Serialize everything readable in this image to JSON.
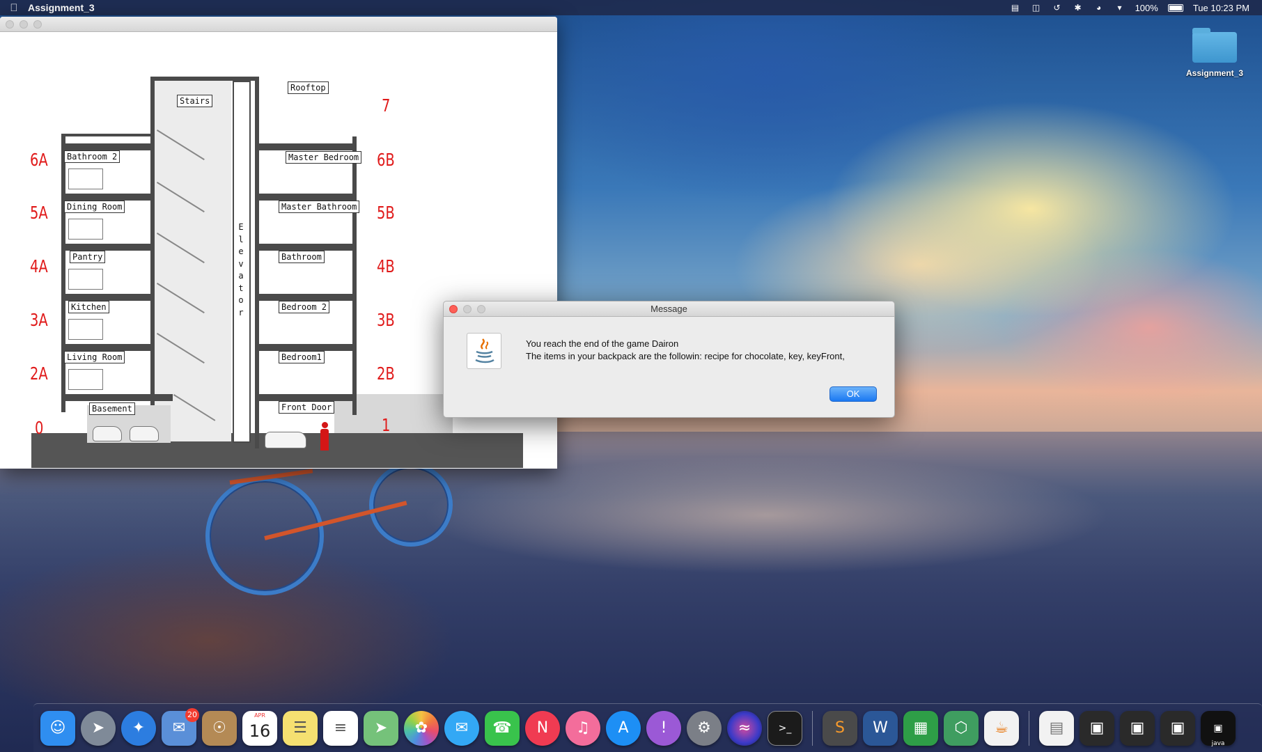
{
  "menubar": {
    "app_name": "Assignment_3",
    "battery": "100%",
    "clock": "Tue 10:23 PM",
    "icons": [
      "apple-icon",
      "notification-icon",
      "mission-control-icon",
      "time-machine-icon",
      "bluetooth-icon",
      "wifi-icon",
      "volume-icon",
      "battery-icon"
    ]
  },
  "desktop": {
    "icons": [
      {
        "label": "Assignment_3",
        "icon": "folder-icon"
      }
    ]
  },
  "game": {
    "rooms": {
      "rooftop": "Rooftop",
      "stairs": "Stairs",
      "bathroom2": "Bathroom 2",
      "master_bedroom": "Master Bedroom",
      "dining_room": "Dining Room",
      "master_bathroom": "Master Bathroom",
      "pantry": "Pantry",
      "bathroom": "Bathroom",
      "kitchen": "Kitchen",
      "bedroom2": "Bedroom 2",
      "living_room": "Living Room",
      "bedroom1": "Bedroom1",
      "basement": "Basement",
      "front_door": "Front Door"
    },
    "elevator": "Elevator",
    "floors_left": [
      "6A",
      "5A",
      "4A",
      "3A",
      "2A",
      "0"
    ],
    "floors_right": [
      "7",
      "6B",
      "5B",
      "4B",
      "3B",
      "2B",
      "1"
    ]
  },
  "dialog": {
    "title": "Message",
    "line1": "You reach the end of the game Dairon",
    "line2": "The items in your backpack are the followin: recipe for chocolate, key, keyFront,",
    "ok_label": "OK",
    "icon": "java-icon"
  },
  "dock": {
    "apps": [
      {
        "name": "Finder",
        "icon": "finder-icon",
        "color": "#2f8ef0"
      },
      {
        "name": "Launchpad",
        "icon": "rocket-icon",
        "color": "#7f8a98"
      },
      {
        "name": "Safari",
        "icon": "compass-icon",
        "color": "#2c7de0"
      },
      {
        "name": "Mail",
        "icon": "mail-icon",
        "color": "#5a8fd8",
        "badge": "20"
      },
      {
        "name": "Contacts",
        "icon": "contacts-icon",
        "color": "#b48a55"
      },
      {
        "name": "Calendar",
        "icon": "calendar-icon",
        "color": "#ffffff",
        "month": "APR",
        "day": "16"
      },
      {
        "name": "Notes",
        "icon": "notes-icon",
        "color": "#f5e071"
      },
      {
        "name": "Reminders",
        "icon": "reminders-icon",
        "color": "#ffffff"
      },
      {
        "name": "Maps",
        "icon": "maps-icon",
        "color": "#75c27a"
      },
      {
        "name": "Photos",
        "icon": "photos-icon",
        "color": "#ffffff"
      },
      {
        "name": "Messages",
        "icon": "messages-icon",
        "color": "#33a8f5"
      },
      {
        "name": "FaceTime",
        "icon": "facetime-icon",
        "color": "#39c34c"
      },
      {
        "name": "News",
        "icon": "news-icon",
        "color": "#f03b52"
      },
      {
        "name": "iTunes",
        "icon": "music-icon",
        "color": "#f36d9b"
      },
      {
        "name": "App Store",
        "icon": "app-store-icon",
        "color": "#1d8ff5"
      },
      {
        "name": "Feedback Assistant",
        "icon": "feedback-icon",
        "color": "#9b59d6"
      },
      {
        "name": "System Preferences",
        "icon": "gear-icon",
        "color": "#7b7f87"
      },
      {
        "name": "Siri",
        "icon": "siri-icon",
        "color": "#1d1d3a"
      },
      {
        "name": "Terminal",
        "icon": "terminal-icon",
        "color": "#1b1b1b"
      },
      {
        "name": "Sublime Text",
        "icon": "sublime-icon",
        "color": "#4a4a4a"
      },
      {
        "name": "Word",
        "icon": "word-icon",
        "color": "#2b5797"
      },
      {
        "name": "Numbers",
        "icon": "chart-icon",
        "color": "#2e9e47"
      },
      {
        "name": "Blender",
        "icon": "cube-icon",
        "color": "#3f9d60"
      },
      {
        "name": "Java",
        "icon": "java-icon",
        "color": "#f2f2f2"
      }
    ],
    "recents": [
      {
        "name": "Document",
        "icon": "document-icon"
      },
      {
        "name": "Window 1",
        "icon": "window-icon"
      },
      {
        "name": "Window 2",
        "icon": "window-icon"
      },
      {
        "name": "Window 3",
        "icon": "window-icon"
      },
      {
        "name": "java",
        "icon": "java-window-icon",
        "label": "java"
      }
    ]
  }
}
